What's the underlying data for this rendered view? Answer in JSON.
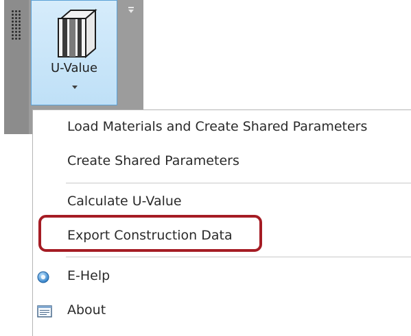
{
  "toolbar": {
    "uvalue_button_label": "U-Value"
  },
  "menu": {
    "items": [
      {
        "label": "Load Materials and Create Shared Parameters",
        "icon": null
      },
      {
        "label": "Create Shared Parameters",
        "icon": null
      },
      {
        "label": "Calculate U-Value",
        "icon": null
      },
      {
        "label": "Export Construction Data",
        "icon": null,
        "highlighted": true
      },
      {
        "label": "E-Help",
        "icon": "help-icon"
      },
      {
        "label": "About",
        "icon": "about-icon"
      }
    ]
  },
  "colors": {
    "highlight_border": "#a51c24",
    "button_active": "#bfe0f7",
    "ribbon_gray": "#9c9c9c"
  }
}
